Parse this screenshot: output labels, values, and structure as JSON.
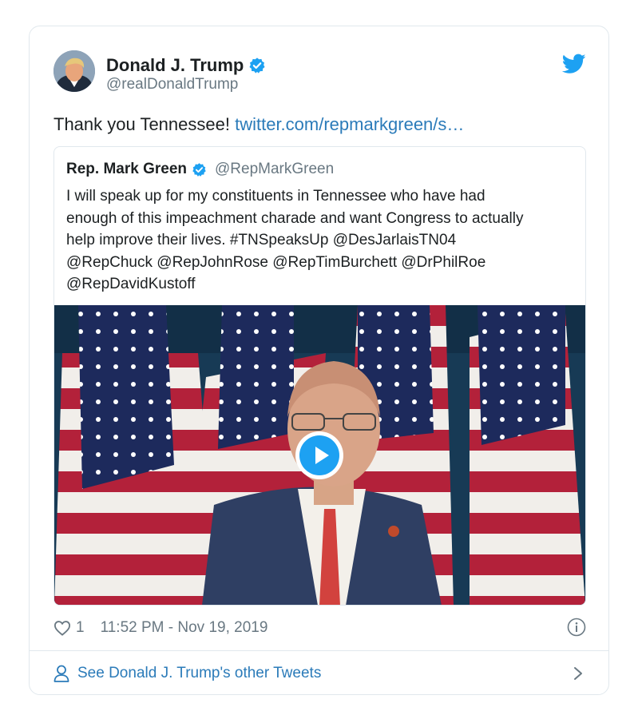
{
  "author": {
    "name": "Donald J. Trump",
    "handle": "@realDonaldTrump",
    "verified_icon": "verified-badge-icon",
    "avatar_icon": "avatar"
  },
  "tweet": {
    "text": "Thank you Tennessee! ",
    "link": "twitter.com/repmarkgreen/s…"
  },
  "quoted": {
    "name": "Rep. Mark Green",
    "handle": "@RepMarkGreen",
    "lines": [
      "I will speak up for my constituents in Tennessee who have had",
      "enough of this impeachment charade and want Congress to actually",
      "help improve their lives. #TNSpeaksUp @DesJarlaisTN04",
      "@RepChuck @RepJohnRose @RepTimBurchett @DrPhilRoe",
      "@RepDavidKustoff"
    ],
    "media": {
      "type": "video",
      "play_icon": "play-icon"
    }
  },
  "footer": {
    "likes": "1",
    "timestamp": "11:52 PM - Nov 19, 2019",
    "heart_icon": "heart-icon",
    "info_icon": "info-icon"
  },
  "see_more": {
    "label": "See Donald J. Trump's other Tweets",
    "person_icon": "person-icon",
    "chevron_icon": "chevron-right-icon"
  },
  "colors": {
    "link": "#2b7bb9",
    "twitter_blue": "#1da1f2",
    "muted": "#697882",
    "border": "#e1e8ed"
  }
}
